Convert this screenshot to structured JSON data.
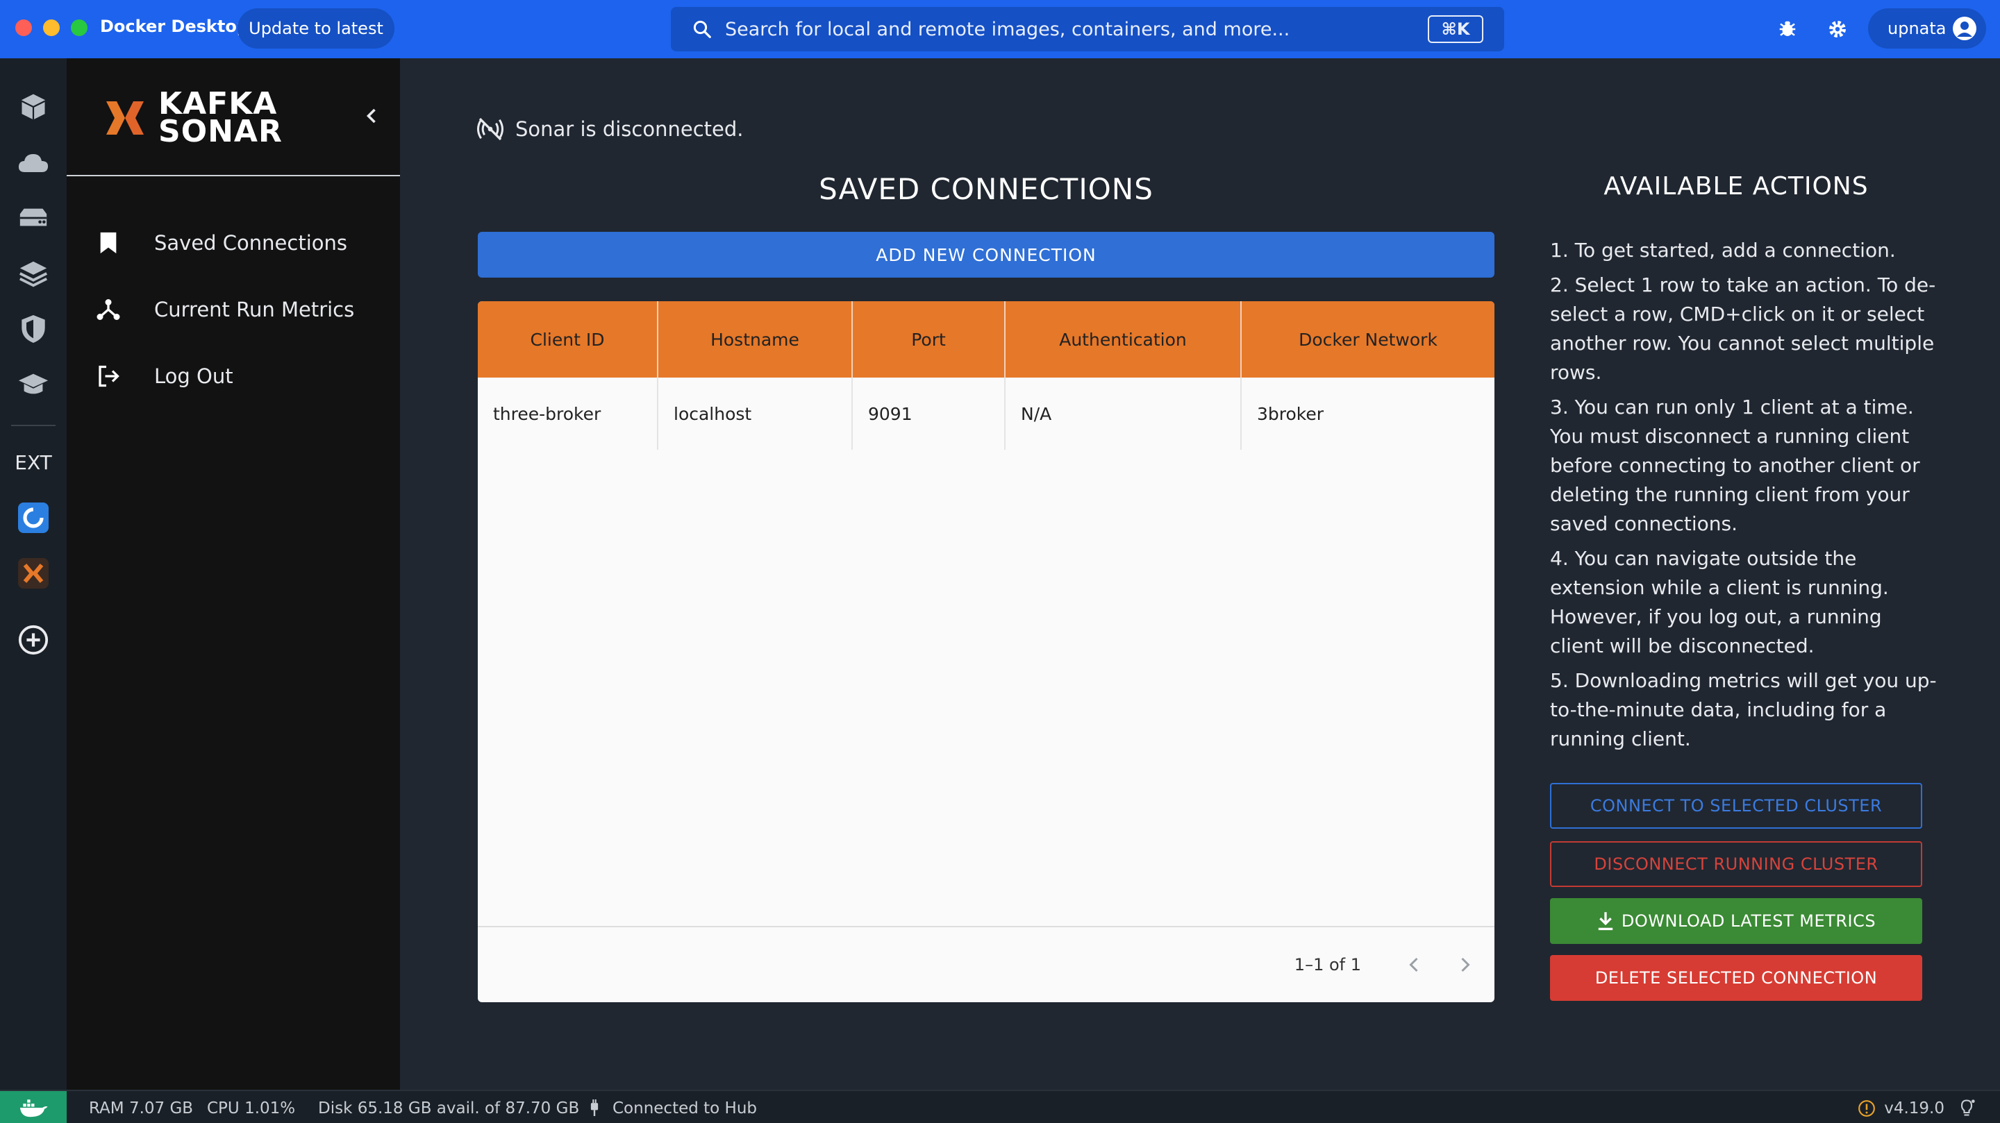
{
  "window": {
    "app_title": "Docker Desktop",
    "update_label": "Update to latest",
    "search_placeholder": "Search for local and remote images, containers, and more...",
    "search_shortcut": "⌘K",
    "username": "upnata"
  },
  "rail": {
    "ext_label": "EXT",
    "icons": [
      "containers-icon",
      "images-icon",
      "volumes-icon",
      "dev-environments-icon",
      "scout-icon",
      "learning-center-icon",
      "extension-1-icon",
      "kafka-sonar-extension-icon",
      "add-extension-icon"
    ]
  },
  "sidebar": {
    "logo_line1": "KAFKA",
    "logo_line2": "SONAR",
    "items": [
      {
        "label": "Saved Connections",
        "icon": "bookmark-icon"
      },
      {
        "label": "Current Run Metrics",
        "icon": "metrics-icon"
      },
      {
        "label": "Log Out",
        "icon": "logout-icon"
      }
    ]
  },
  "main": {
    "status": "Sonar is disconnected.",
    "title": "SAVED CONNECTIONS",
    "add_button": "ADD NEW CONNECTION",
    "table": {
      "headers": [
        "Client ID",
        "Hostname",
        "Port",
        "Authentication",
        "Docker Network"
      ],
      "rows": [
        [
          "three-broker",
          "localhost",
          "9091",
          "N/A",
          "3broker"
        ]
      ],
      "pagination": "1–1 of 1"
    }
  },
  "actions": {
    "title": "AVAILABLE ACTIONS",
    "instructions": [
      "1. To get started, add a connection.",
      "2. Select 1 row to take an action. To de-select a row, CMD+click on it or select another row. You cannot select multiple rows.",
      "3. You can run only 1 client at a time. You must disconnect a running client before connecting to another client or deleting the running client from your saved connections.",
      "4. You can navigate outside the extension while a client is running. However, if you log out, a running client will be disconnected.",
      "5. Downloading metrics will get you up-to-the-minute data, including for a running client."
    ],
    "connect": "CONNECT TO SELECTED CLUSTER",
    "disconnect": "DISCONNECT RUNNING CLUSTER",
    "download": "DOWNLOAD LATEST METRICS",
    "delete": "DELETE SELECTED CONNECTION"
  },
  "footer": {
    "ram": "RAM 7.07 GB",
    "cpu": "CPU 1.01%",
    "disk": "Disk 65.18 GB avail. of 87.70 GB",
    "hub": "Connected to Hub",
    "version": "v4.19.0"
  },
  "colors": {
    "titlebar": "#1d63ed",
    "accent_orange": "#e67829",
    "primary_blue": "#2f6fd6",
    "success_green": "#3b8a35",
    "danger_red": "#d63c33"
  }
}
